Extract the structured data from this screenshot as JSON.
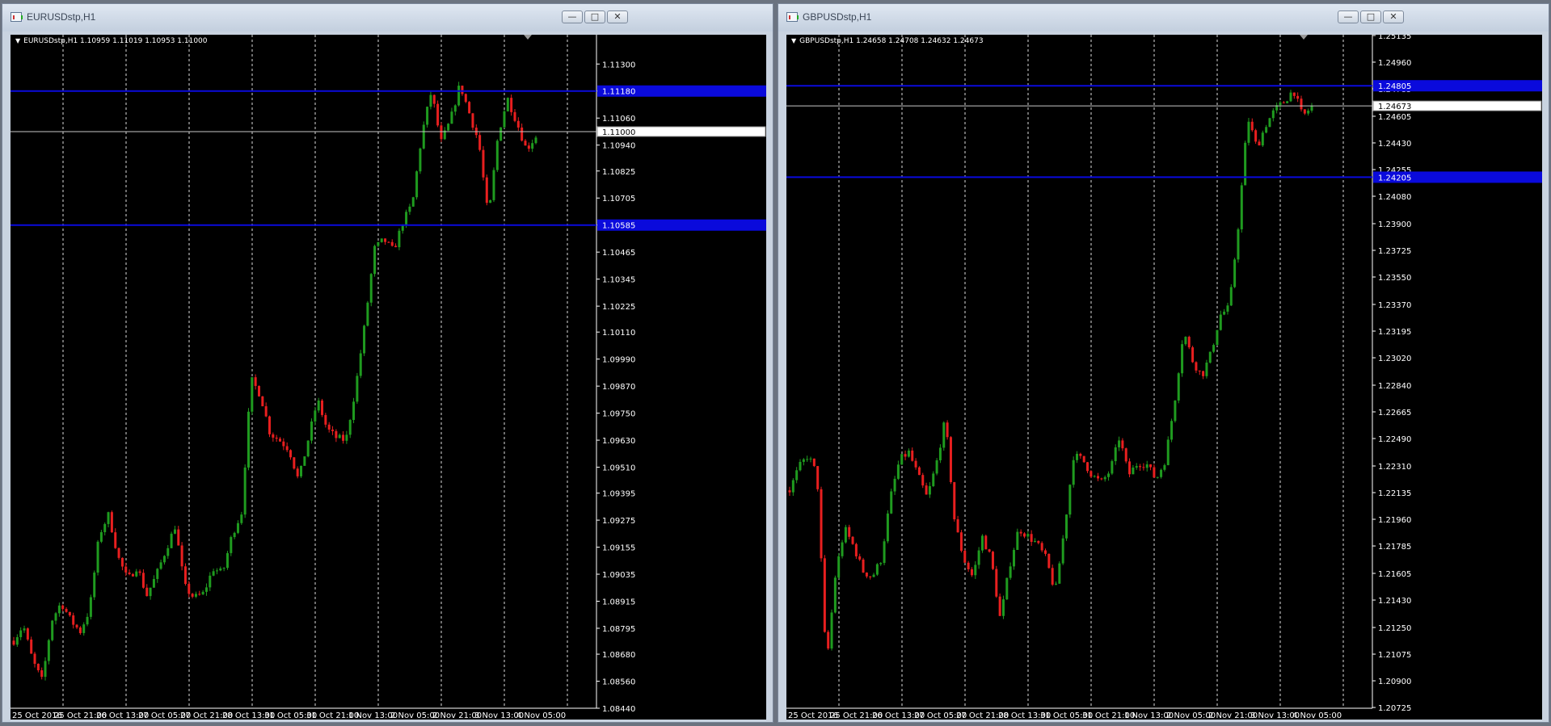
{
  "windows": [
    {
      "title": "EURUSDstp,H1",
      "info": "EURUSDstp,H1  1.10959 1.11019 1.10953 1.11000",
      "y_min": 1.0844,
      "y_max": 1.1143,
      "ticks": [
        "1.11300",
        "1.11180",
        "1.11060",
        "1.10940",
        "1.10825",
        "1.10705",
        "1.10585",
        "1.10465",
        "1.10345",
        "1.10225",
        "1.10110",
        "1.09990",
        "1.09870",
        "1.09750",
        "1.09630",
        "1.09510",
        "1.09395",
        "1.09275",
        "1.09155",
        "1.09035",
        "1.08915",
        "1.08795",
        "1.08680",
        "1.08560",
        "1.08440"
      ],
      "current_price": "1.11000",
      "blue_levels": [
        "1.11180",
        "1.10585"
      ],
      "x_labels": [
        "25 Oct 2016",
        "25 Oct 21:00",
        "26 Oct 13:00",
        "27 Oct 05:00",
        "27 Oct 21:00",
        "28 Oct 13:00",
        "31 Oct 05:00",
        "31 Oct 21:00",
        "1 Nov 13:00",
        "2 Nov 05:00",
        "2 Nov 21:00",
        "3 Nov 13:00",
        "4 Nov 05:00"
      ],
      "path": [
        1.0874,
        1.0881,
        1.0865,
        1.0856,
        1.0883,
        1.0891,
        1.0883,
        1.0878,
        1.0888,
        1.0921,
        1.093,
        1.0911,
        1.0901,
        1.0907,
        1.0894,
        1.0903,
        1.0914,
        1.0925,
        1.0898,
        1.0893,
        1.0895,
        1.0906,
        1.0904,
        1.0921,
        1.0931,
        1.099,
        1.0983,
        1.0966,
        1.0963,
        1.0959,
        1.0945,
        1.0963,
        1.0981,
        1.0968,
        1.0964,
        1.0963,
        1.0986,
        1.1015,
        1.1048,
        1.1052,
        1.1047,
        1.106,
        1.1068,
        1.1099,
        1.1118,
        1.1095,
        1.1105,
        1.1121,
        1.1108,
        1.1095,
        1.1061,
        1.1098,
        1.1115,
        1.1104,
        1.1092,
        1.1098
      ]
    },
    {
      "title": "GBPUSDstp,H1",
      "info": "GBPUSDstp,H1  1.24658 1.24708 1.24632 1.24673",
      "y_min": 1.2072,
      "y_max": 1.2514,
      "ticks": [
        "1.25135",
        "1.24960",
        "1.24785",
        "1.24605",
        "1.24430",
        "1.24255",
        "1.24080",
        "1.23900",
        "1.23725",
        "1.23550",
        "1.23370",
        "1.23195",
        "1.23020",
        "1.22840",
        "1.22665",
        "1.22490",
        "1.22310",
        "1.22135",
        "1.21960",
        "1.21785",
        "1.21605",
        "1.21430",
        "1.21250",
        "1.21075",
        "1.20900",
        "1.20725"
      ],
      "current_price": "1.24673",
      "blue_levels": [
        "1.24805",
        "1.24205"
      ],
      "x_labels": [
        "25 Oct 2016",
        "25 Oct 21:00",
        "26 Oct 13:00",
        "27 Oct 05:00",
        "27 Oct 21:00",
        "28 Oct 13:00",
        "31 Oct 05:00",
        "31 Oct 21:00",
        "1 Nov 13:00",
        "2 Nov 05:00",
        "2 Nov 21:00",
        "3 Nov 13:00",
        "4 Nov 05:00"
      ],
      "path": [
        1.2215,
        1.223,
        1.2238,
        1.2225,
        1.2098,
        1.216,
        1.219,
        1.2178,
        1.2162,
        1.2158,
        1.217,
        1.221,
        1.2235,
        1.224,
        1.2225,
        1.221,
        1.2232,
        1.2262,
        1.2195,
        1.217,
        1.2158,
        1.2185,
        1.217,
        1.213,
        1.2165,
        1.219,
        1.2185,
        1.218,
        1.217,
        1.2148,
        1.219,
        1.2238,
        1.2235,
        1.2225,
        1.222,
        1.2228,
        1.225,
        1.2225,
        1.2233,
        1.2232,
        1.2222,
        1.2235,
        1.2272,
        1.232,
        1.23,
        1.229,
        1.2305,
        1.233,
        1.2335,
        1.239,
        1.246,
        1.244,
        1.2455,
        1.2465,
        1.247,
        1.2478,
        1.246,
        1.2467
      ]
    }
  ]
}
